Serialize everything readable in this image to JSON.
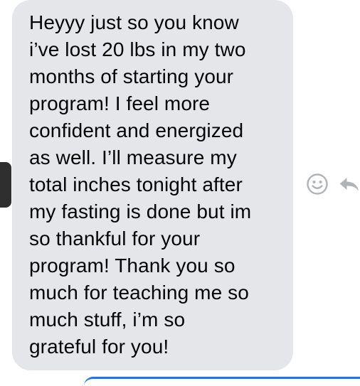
{
  "message": {
    "text": "Heyyy just so you know\ni’ve lost 20 lbs in my two\nmonths of starting your\nprogram! I feel more\nconfident and energized\nas well. I’ll measure my\ntotal inches tonight after\nmy fasting is done but im\nso thankful for your\nprogram! Thank you so\nmuch for teaching me so\nmuch stuff, i’m so\ngrateful for you!"
  },
  "actions": {
    "react_icon": "smiley-icon",
    "reply_icon": "reply-icon"
  },
  "colors": {
    "bubble": "#e5e6ea",
    "text": "#050505",
    "icon": "#b0b3b8",
    "accent": "#1877f2"
  }
}
